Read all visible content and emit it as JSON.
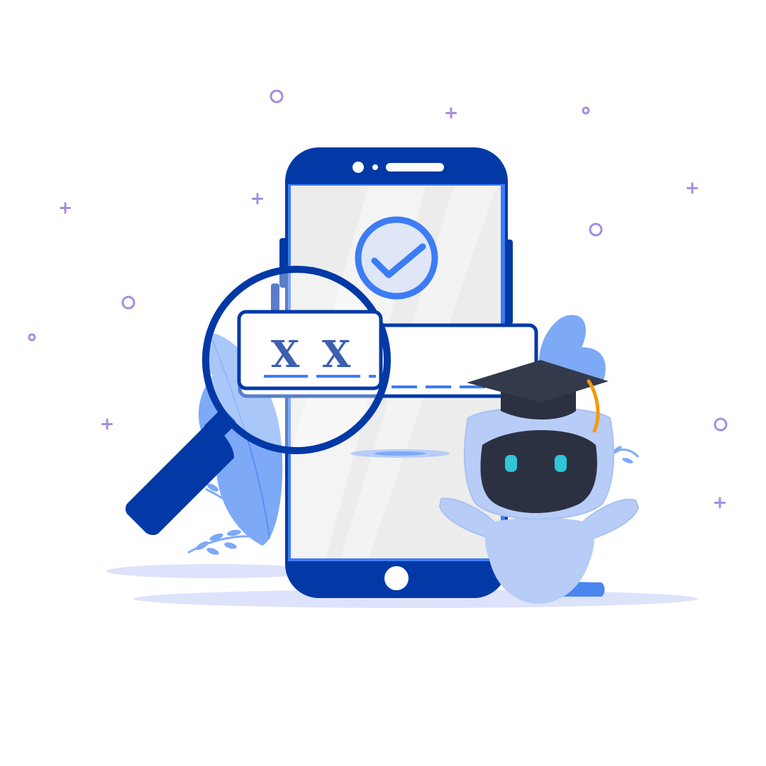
{
  "illustration": {
    "masked_field": {
      "characters": [
        "X",
        "X"
      ]
    },
    "colors": {
      "navy": "#0339a6",
      "blue": "#3c7cf5",
      "light_blue": "#7da9f7",
      "pale_blue": "#b7ccf7",
      "screen_gray": "#ececec",
      "robot_face": "#2c3142",
      "robot_eye": "#2ec6d8",
      "cap": "#333a4c",
      "tassel": "#f29a11",
      "sparkle": "#a58de0",
      "shadow": "#dde3fb"
    },
    "icons": [
      "check-circle-icon",
      "magnifying-glass-icon",
      "graduation-cap-icon"
    ]
  }
}
